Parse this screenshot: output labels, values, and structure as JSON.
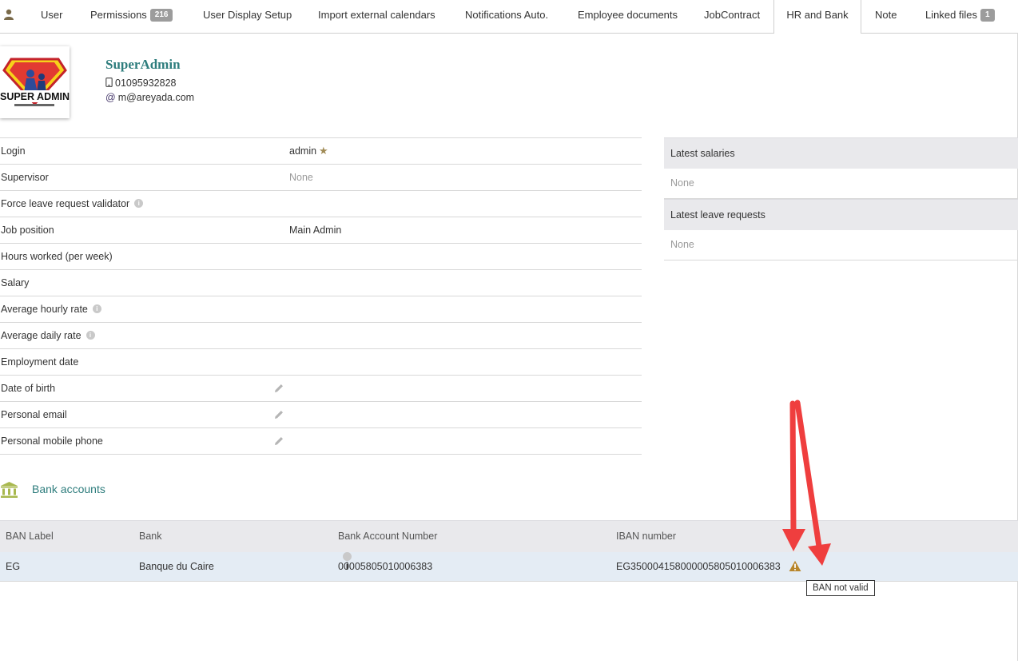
{
  "tabs": [
    {
      "label": "User"
    },
    {
      "label": "Permissions",
      "badge": "216"
    },
    {
      "label": "User Display Setup"
    },
    {
      "label": "Import external calendars"
    },
    {
      "label": "Notifications Auto."
    },
    {
      "label": "Employee documents"
    },
    {
      "label": "JobContract"
    },
    {
      "label": "HR and Bank",
      "active": true
    },
    {
      "label": "Note"
    },
    {
      "label": "Linked files",
      "badge": "1"
    }
  ],
  "profile": {
    "name": "SuperAdmin",
    "phone": "01095932828",
    "email": "m@areyada.com",
    "logo_text": "SUPER ADMIN"
  },
  "fields": [
    {
      "label": "Login",
      "value": "admin"
    },
    {
      "label": "Supervisor",
      "value": "None"
    },
    {
      "label": "Force leave request validator",
      "value": ""
    },
    {
      "label": "Job position",
      "value": "Main Admin"
    },
    {
      "label": "Hours worked (per week)",
      "value": ""
    },
    {
      "label": "Salary",
      "value": ""
    },
    {
      "label": "Average hourly rate",
      "value": ""
    },
    {
      "label": "Average daily rate",
      "value": ""
    },
    {
      "label": "Employment date",
      "value": ""
    },
    {
      "label": "Date of birth",
      "value": ""
    },
    {
      "label": "Personal email",
      "value": ""
    },
    {
      "label": "Personal mobile phone",
      "value": ""
    }
  ],
  "panels": {
    "salaries": {
      "title": "Latest salaries",
      "value": "None"
    },
    "leaves": {
      "title": "Latest leave requests",
      "value": "None"
    }
  },
  "bank": {
    "title": "Bank accounts",
    "headers": {
      "label": "BAN Label",
      "bank": "Bank",
      "account": "Bank Account Number",
      "iban": "IBAN number"
    },
    "rows": [
      {
        "label": "EG",
        "bank": "Banque du Caire",
        "account": "00005805010006383",
        "iban": "EG350004158000005805010006383"
      }
    ],
    "tooltip": "BAN not valid"
  },
  "colors": {
    "accent": "#2e7d7d",
    "annotation": "#ef3e3e",
    "warning": "#b8862b"
  }
}
